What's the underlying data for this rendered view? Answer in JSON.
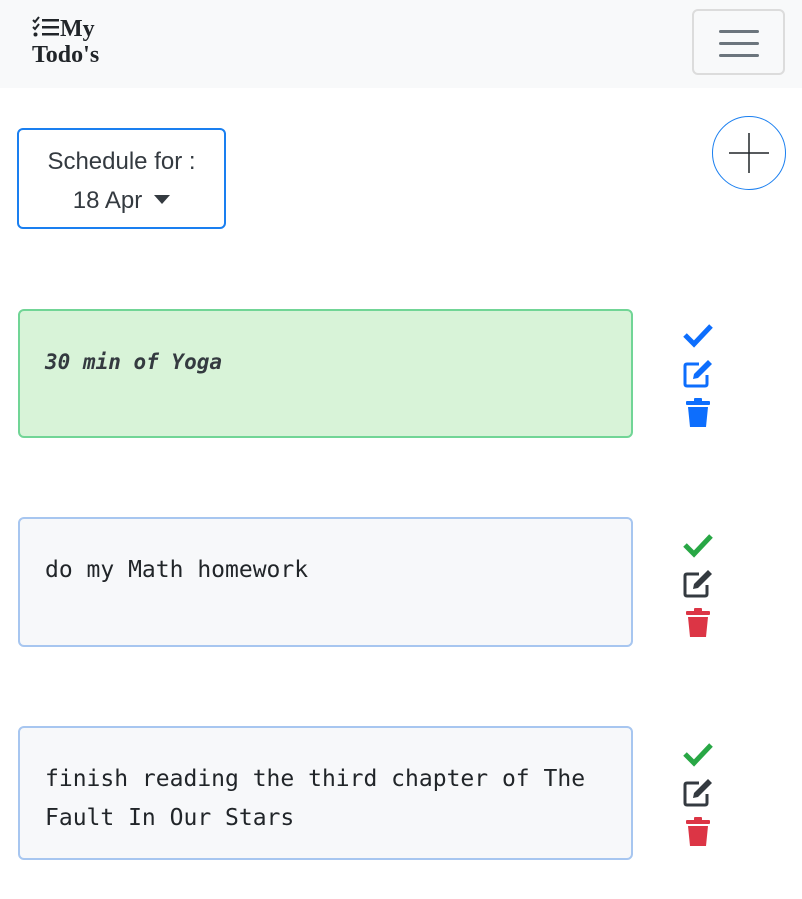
{
  "navbar": {
    "brand": "My Todo's",
    "brand_icon": "checklist-icon",
    "toggler_icon": "hamburger-menu-icon"
  },
  "schedule": {
    "label": "Schedule for :",
    "date": "18 Apr"
  },
  "add_button_icon": "plus-icon",
  "todos": [
    {
      "text": "30 min of Yoga",
      "completed": true
    },
    {
      "text": "do my Math homework",
      "completed": false
    },
    {
      "text": "finish reading the third chapter of The Fault In Our Stars",
      "completed": false
    }
  ],
  "colors": {
    "primary": "#0d6efd",
    "success": "#28a745",
    "danger": "#dc3545",
    "dark": "#343a40",
    "done_bg": "#d8f3d8",
    "done_border": "#71d596"
  }
}
